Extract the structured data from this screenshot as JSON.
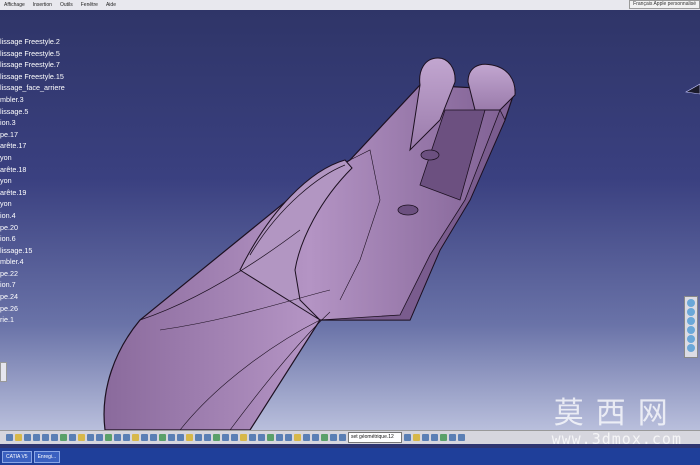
{
  "menubar": {
    "items": [
      "Affichage",
      "Insertion",
      "Outils",
      "Fenêtre",
      "Aide"
    ],
    "lang_tab": "Français Apple personnalisé"
  },
  "tree": {
    "items": [
      "lissage Freestyle.2",
      "lissage Freestyle.5",
      "lissage Freestyle.7",
      "lissage Freestyle.15",
      "lissage_face_arriere",
      "mbler.3",
      "lissage.5",
      "ion.3",
      "pe.17",
      "arête.17",
      "yon",
      "arête.18",
      "yon",
      "arête.19",
      "yon",
      "ion.4",
      "pe.20",
      "ion.6",
      "lissage.15",
      "mbler.4",
      "pe.22",
      "ion.7",
      "pe.24",
      "pe.26",
      "rie.1"
    ]
  },
  "toolbar": {
    "combo_value": "set géométrique.12"
  },
  "taskbar": {
    "items": [
      "CATIA V5",
      "Enregi..."
    ]
  },
  "watermark": {
    "chinese": "莫西网",
    "url": "www.3dmox.com"
  },
  "colors": {
    "part_fill": "#9a7bab",
    "background_top": "#2f3568",
    "background_bottom": "#b9bfdc"
  }
}
